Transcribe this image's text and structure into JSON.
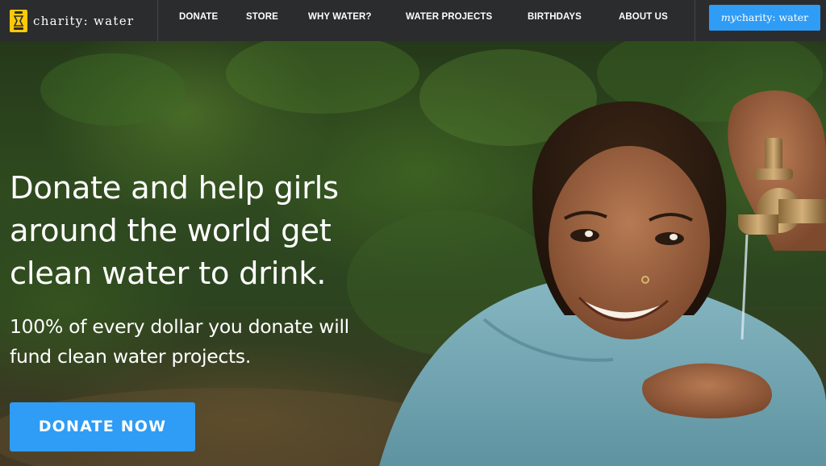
{
  "nav": {
    "logo_text": "charity: water",
    "logo_icon": "jerry-can-icon",
    "items": [
      {
        "label": "DONATE"
      },
      {
        "label": "STORE"
      },
      {
        "label": "WHY WATER?"
      },
      {
        "label": "WATER PROJECTS"
      },
      {
        "label": "BIRTHDAYS"
      },
      {
        "label": "ABOUT US"
      }
    ],
    "mycw_prefix": "my",
    "mycw_suffix": "charity: water"
  },
  "hero": {
    "headline": "Donate and help girls around the world get clean water to drink.",
    "subhead": "100% of every dollar you donate will fund clean water projects.",
    "cta_label": "DONATE NOW",
    "image_subject": "girl-drinking-from-tap-photo"
  },
  "colors": {
    "nav_bg": "#2b2c2e",
    "accent_blue": "#2f9cf5",
    "logo_yellow": "#ffc907"
  }
}
